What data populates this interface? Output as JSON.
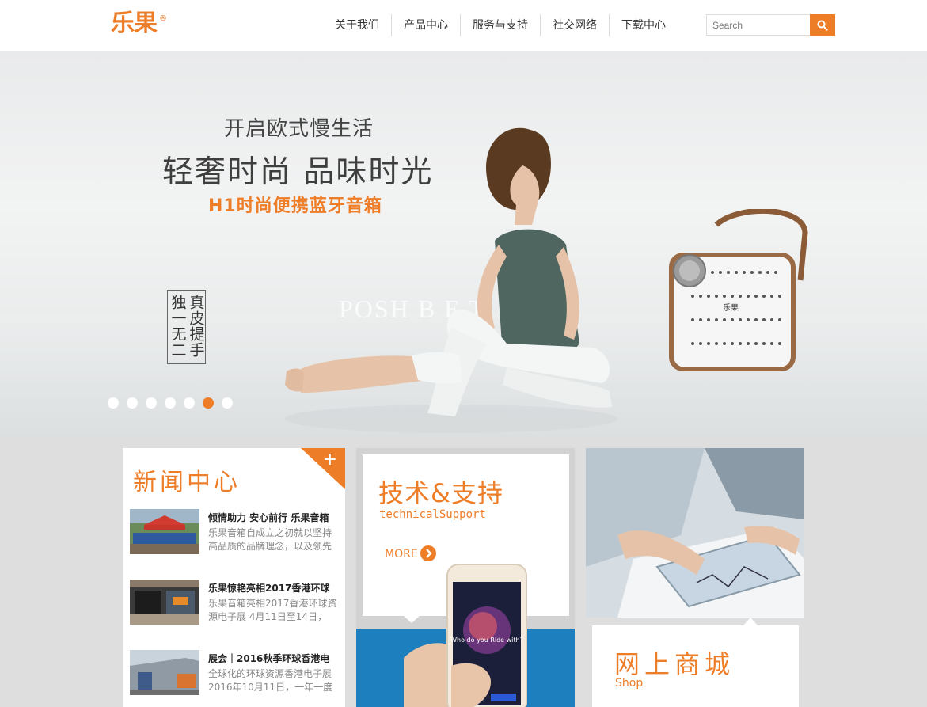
{
  "header": {
    "logo": "乐果",
    "logo_mark": "®",
    "nav": [
      "关于我们",
      "产品中心",
      "服务与支持",
      "社交网络",
      "下载中心"
    ],
    "search_placeholder": "Search",
    "search_icon": "search-icon"
  },
  "banner": {
    "subtitle": "开启欧式慢生活",
    "title": "轻奢时尚  品味时光",
    "product_line": "H1时尚便携蓝牙音箱",
    "stamp_cols": [
      "真皮提手",
      "独一无二"
    ],
    "watermark": "POSH  B        E   T",
    "speaker_logo": "乐果",
    "slide_count": 7,
    "active_slide": 6
  },
  "news": {
    "title": "新闻中心",
    "plus": "+",
    "items": [
      {
        "headline": "倾情助力 安心前行 乐果音箱",
        "desc": "乐果音箱自成立之初就以坚持高品质的品牌理念，以及领先"
      },
      {
        "headline": "乐果惊艳亮相2017香港环球",
        "desc": "乐果音箱亮相2017香港环球资源电子展 4月11日至14日，"
      },
      {
        "headline": "展会｜2016秋季环球香港电",
        "desc": "全球化的环球资源香港电子展2016年10月11日，一年一度"
      }
    ]
  },
  "tech": {
    "title": "技术&支持",
    "subtitle": "technicalSupport",
    "more": "MORE",
    "phone_text": "Who do you Ride with?"
  },
  "shop": {
    "title": "网上商城",
    "subtitle": "Shop"
  },
  "colors": {
    "accent": "#ee7d28",
    "banner_bg": "#e9eaeb",
    "lower_bg": "#dedede",
    "tech_blue": "#1e7fbf"
  }
}
